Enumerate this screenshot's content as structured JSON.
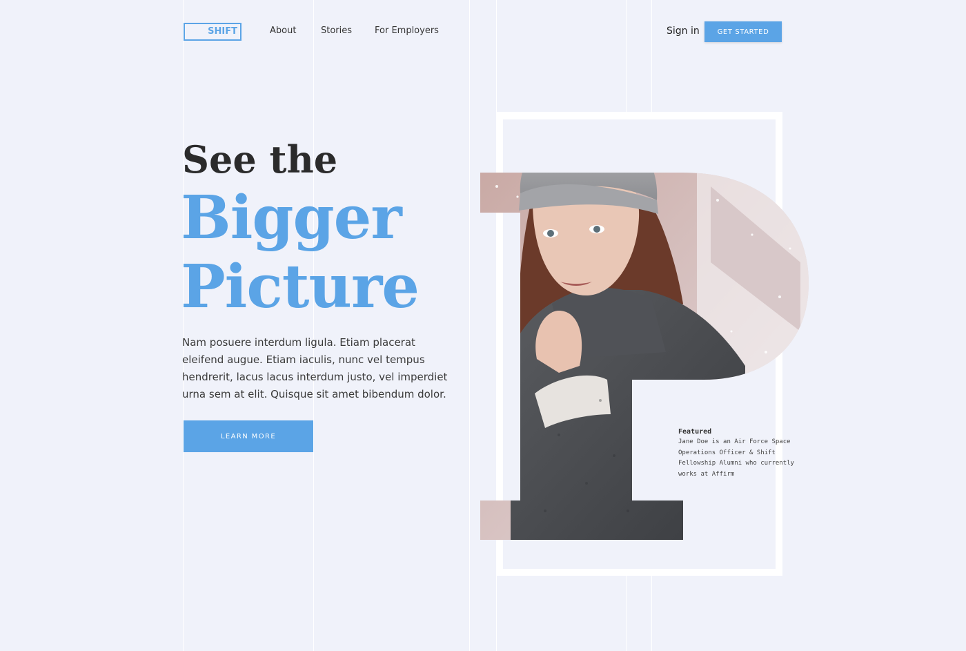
{
  "header": {
    "logo": "SHIFT",
    "nav": [
      "About",
      "Stories",
      "For Employers"
    ],
    "sign_in": "Sign in",
    "cta": "GET STARTED"
  },
  "hero": {
    "line1": "See the",
    "line2": "Bigger",
    "line3": "Picture",
    "body": "Nam posuere interdum ligula. Etiam placerat eleifend augue. Etiam iaculis, nunc vel tempus hendrerit, lacus lacus interdum justo, vel imperdiet urna sem at elit. Quisque sit amet bibendum dolor.",
    "button": "LEARN MORE"
  },
  "featured": {
    "title": "Featured",
    "text": "Jane Doe is an Air Force Space Operations Officer & Shift Fellowship Alumni who currently works at Affirm"
  },
  "colors": {
    "accent": "#5ba4e6",
    "background": "#f0f2fa",
    "heading": "#2b2b2b"
  }
}
